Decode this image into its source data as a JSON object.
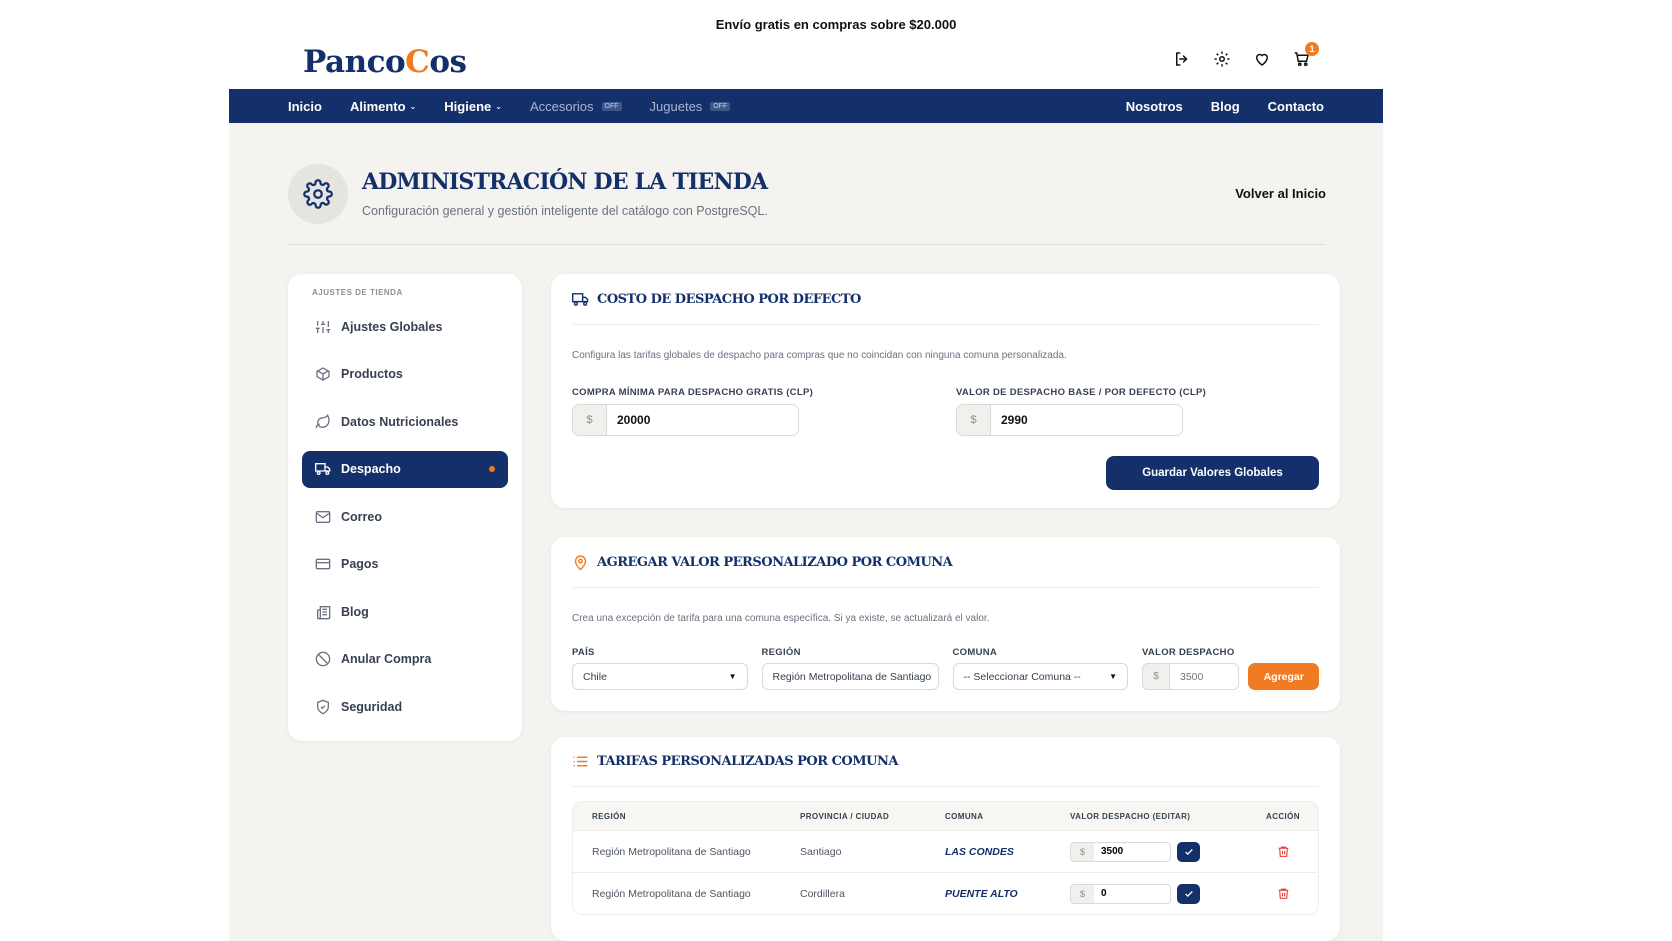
{
  "announcement": "Envío gratis en compras sobre $20.000",
  "logo": {
    "part1": "Panco",
    "part2": "C",
    "part3": "os"
  },
  "cart_count": "1",
  "nav": {
    "left": [
      {
        "label": "Inicio",
        "dropdown": false,
        "off": false
      },
      {
        "label": "Alimento",
        "dropdown": true,
        "off": false
      },
      {
        "label": "Higiene",
        "dropdown": true,
        "off": false
      },
      {
        "label": "Accesorios",
        "dropdown": false,
        "off": true,
        "tag": "OFF"
      },
      {
        "label": "Juguetes",
        "dropdown": false,
        "off": true,
        "tag": "OFF"
      }
    ],
    "right": [
      "Nosotros",
      "Blog",
      "Contacto"
    ]
  },
  "page": {
    "title": "ADMINISTRACIÓN DE LA TIENDA",
    "subtitle": "Configuración general y gestión inteligente del catálogo con PostgreSQL.",
    "back": "Volver al Inicio"
  },
  "sidebar": {
    "heading": "AJUSTES DE TIENDA",
    "items": [
      {
        "label": "Ajustes Globales",
        "icon": "sliders-icon"
      },
      {
        "label": "Productos",
        "icon": "box-icon"
      },
      {
        "label": "Datos Nutricionales",
        "icon": "leaf-icon"
      },
      {
        "label": "Despacho",
        "icon": "truck-icon",
        "active": true
      },
      {
        "label": "Correo",
        "icon": "mail-icon"
      },
      {
        "label": "Pagos",
        "icon": "card-icon"
      },
      {
        "label": "Blog",
        "icon": "newspaper-icon"
      },
      {
        "label": "Anular Compra",
        "icon": "ban-icon"
      },
      {
        "label": "Seguridad",
        "icon": "shield-icon"
      }
    ]
  },
  "shipping_default": {
    "title": "COSTO DE DESPACHO POR DEFECTO",
    "desc": "Configura las tarifas globales de despacho para compras que no coincidan con ninguna comuna personalizada.",
    "min_label": "COMPRA MÍNIMA PARA DESPACHO GRATIS (CLP)",
    "min_value": "20000",
    "base_label": "VALOR DE DESPACHO BASE / POR DEFECTO (CLP)",
    "base_value": "2990",
    "currency": "$",
    "save": "Guardar Valores Globales"
  },
  "custom_add": {
    "title": "AGREGAR VALOR PERSONALIZADO POR COMUNA",
    "desc": "Crea una excepción de tarifa para una comuna específica. Si ya existe, se actualizará el valor.",
    "pais_label": "PAÍS",
    "pais_value": "Chile",
    "region_label": "REGIÓN",
    "region_value": "Región Metropolitana de Santiago",
    "comuna_label": "COMUNA",
    "comuna_value": "-- Seleccionar Comuna --",
    "valor_label": "VALOR DESPACHO",
    "valor_placeholder": "3500",
    "add": "Agregar"
  },
  "tariffs": {
    "title": "TARIFAS PERSONALIZADAS POR COMUNA",
    "headers": [
      "REGIÓN",
      "PROVINCIA / CIUDAD",
      "COMUNA",
      "VALOR DESPACHO (EDITAR)",
      "ACCIÓN"
    ],
    "rows": [
      {
        "region": "Región Metropolitana de Santiago",
        "provincia": "Santiago",
        "comuna": "LAS CONDES",
        "valor": "3500"
      },
      {
        "region": "Región Metropolitana de Santiago",
        "provincia": "Cordillera",
        "comuna": "PUENTE ALTO",
        "valor": "0"
      }
    ]
  },
  "colors": {
    "navy": "#14306b",
    "orange": "#f07b22",
    "bg": "#f5f3ef"
  }
}
